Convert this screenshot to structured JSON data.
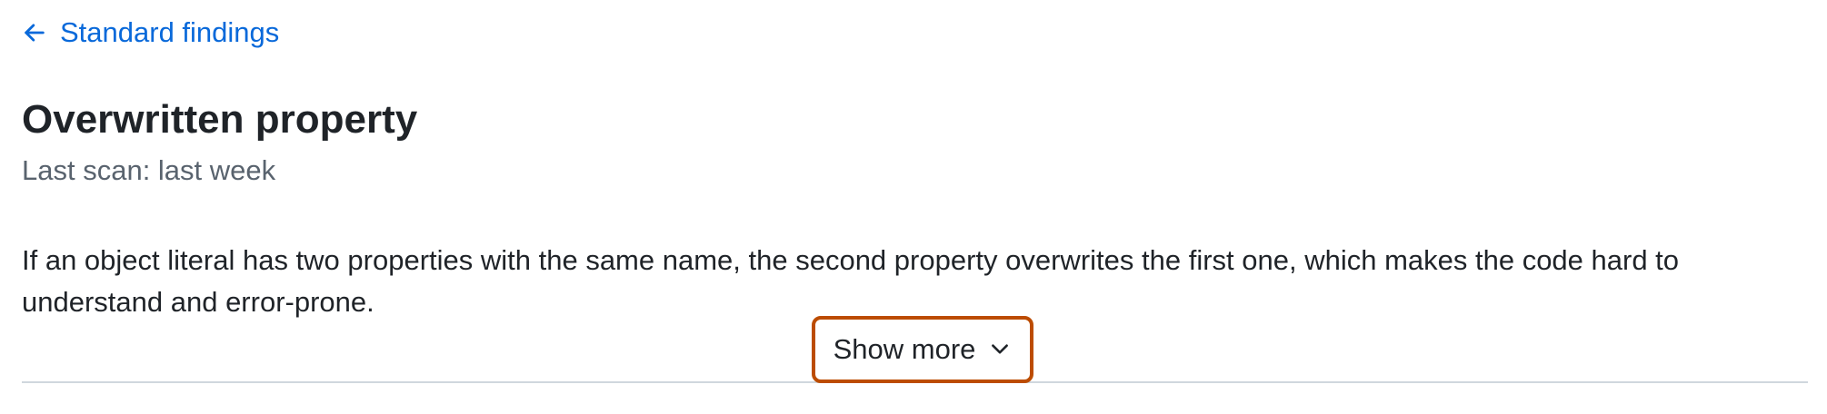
{
  "navigation": {
    "back_link_label": "Standard findings",
    "back_icon": "arrow-left-icon"
  },
  "finding": {
    "title": "Overwritten property",
    "last_scan": "Last scan: last week",
    "description": "If an object literal has two properties with the same name, the second property overwrites the first one, which makes the code hard to understand and error-prone."
  },
  "actions": {
    "show_more_label": "Show more",
    "show_more_icon": "chevron-down-icon"
  },
  "colors": {
    "link": "#0969da",
    "text": "#1f2328",
    "muted": "#59636e",
    "focus_outline": "#bc4c00",
    "divider": "#d0d7de"
  }
}
